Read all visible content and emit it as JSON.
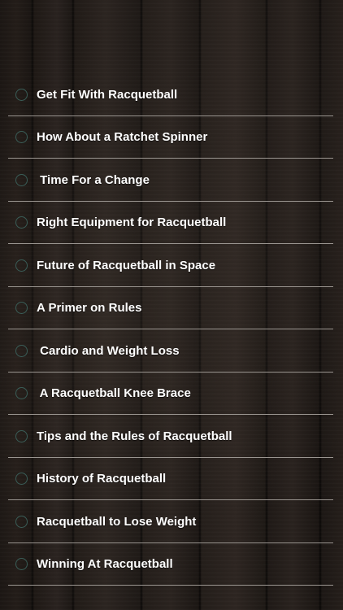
{
  "menu": {
    "items": [
      {
        "label": "Get Fit With Racquetball"
      },
      {
        "label": "How About a Ratchet Spinner"
      },
      {
        "label": " Time For a Change"
      },
      {
        "label": "Right Equipment for Racquetball"
      },
      {
        "label": "Future of Racquetball in Space"
      },
      {
        "label": "A Primer on Rules"
      },
      {
        "label": " Cardio and Weight Loss"
      },
      {
        "label": " A Racquetball Knee Brace"
      },
      {
        "label": "Tips and the Rules of Racquetball"
      },
      {
        "label": "History of Racquetball"
      },
      {
        "label": "Racquetball to Lose Weight"
      },
      {
        "label": "Winning At Racquetball"
      }
    ]
  },
  "colors": {
    "background": "#1a1512",
    "text": "#ffffff",
    "divider": "#9a9590",
    "radio_border": "#3a5e58"
  },
  "icons": {
    "item_icon": "radio-circle-icon"
  }
}
